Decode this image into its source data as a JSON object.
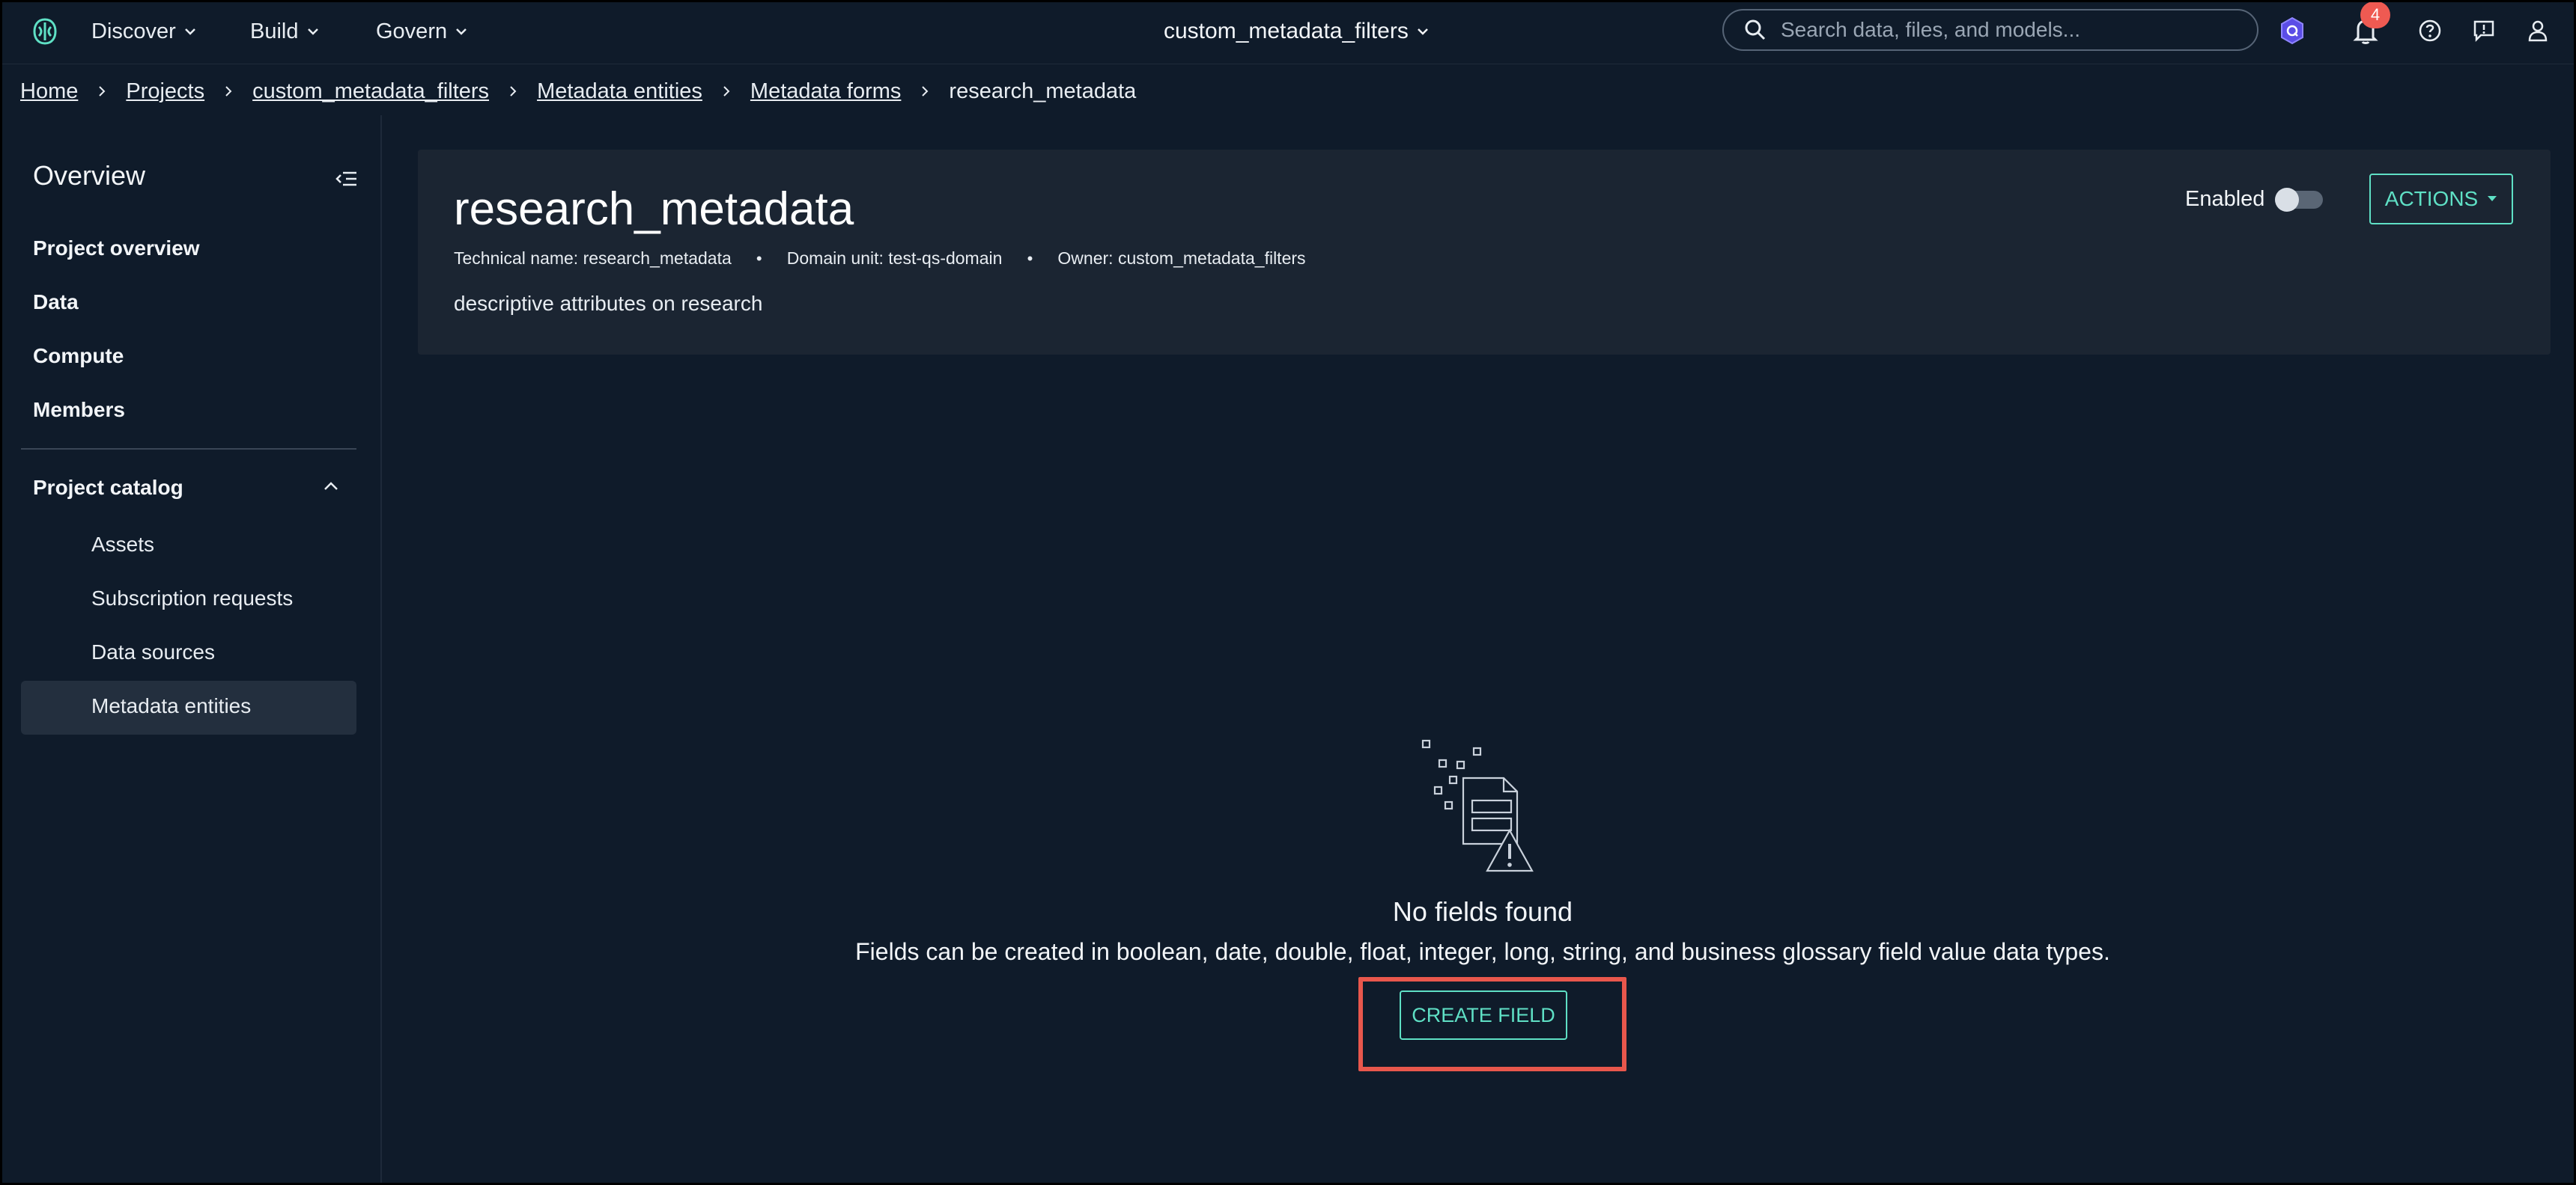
{
  "topnav": {
    "menus": [
      {
        "label": "Discover"
      },
      {
        "label": "Build"
      },
      {
        "label": "Govern"
      }
    ],
    "project": "custom_metadata_filters",
    "search_placeholder": "Search data, files, and models...",
    "notifications_count": "4"
  },
  "breadcrumb": {
    "links": [
      "Home",
      "Projects",
      "custom_metadata_filters",
      "Metadata entities",
      "Metadata forms"
    ],
    "current": "research_metadata"
  },
  "sidebar": {
    "title": "Overview",
    "items": [
      "Project overview",
      "Data",
      "Compute",
      "Members"
    ],
    "catalog_label": "Project catalog",
    "catalog_items": [
      "Assets",
      "Subscription requests",
      "Data sources",
      "Metadata entities"
    ],
    "active_item": "Metadata entities"
  },
  "form": {
    "title": "research_metadata",
    "technical_name_label": "Technical name:",
    "technical_name": "research_metadata",
    "domain_unit_label": "Domain unit:",
    "domain_unit": "test-qs-domain",
    "owner_label": "Owner:",
    "owner": "custom_metadata_filters",
    "description": "descriptive attributes on research",
    "enabled_label": "Enabled",
    "enabled": false,
    "actions_label": "ACTIONS"
  },
  "empty_state": {
    "title": "No fields found",
    "description": "Fields can be created in boolean, date, double, float, integer, long, string, and business glossary field value data types.",
    "button_label": "CREATE FIELD"
  },
  "colors": {
    "background": "#0f1b2a",
    "card": "#1b2532",
    "accent": "#5fe0c5",
    "highlight": "#e8574c",
    "badge": "#ef5a52"
  }
}
